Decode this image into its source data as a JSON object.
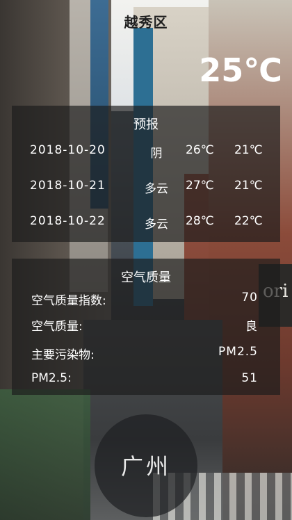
{
  "header": {
    "district": "越秀区",
    "current_temp": "25℃"
  },
  "forecast": {
    "title": "预报",
    "days": [
      {
        "date": "2018-10-20",
        "condition": "阴",
        "high": "26℃",
        "low": "21℃"
      },
      {
        "date": "2018-10-21",
        "condition": "多云",
        "high": "27℃",
        "low": "21℃"
      },
      {
        "date": "2018-10-22",
        "condition": "多云",
        "high": "28℃",
        "low": "22℃"
      }
    ]
  },
  "air_quality": {
    "title": "空气质量",
    "rows": [
      {
        "label": "空气质量指数:",
        "value": "70"
      },
      {
        "label": "空气质量:",
        "value": "良"
      },
      {
        "label": "主要污染物:",
        "value": "PM2.5"
      },
      {
        "label": "PM2.5:",
        "value": "51"
      }
    ]
  },
  "city": {
    "name": "广州"
  }
}
